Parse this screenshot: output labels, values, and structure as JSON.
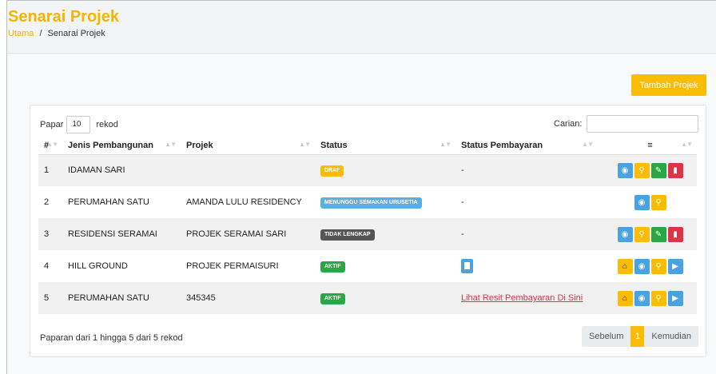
{
  "page": {
    "title": "Senarai Projek",
    "breadcrumb_home": "Utama",
    "breadcrumb_sep": "/",
    "breadcrumb_current": "Senarai Projek"
  },
  "toolbar": {
    "add_label": "Tambah Projek"
  },
  "table_controls": {
    "show_prefix": "Papar",
    "show_value": "10",
    "show_suffix": "rekod",
    "search_label": "Carian:",
    "search_value": ""
  },
  "columns": [
    "#",
    "Jenis Pembangunan",
    "Projek",
    "Status",
    "Status Pembayaran",
    "≡"
  ],
  "rows": [
    {
      "no": "1",
      "jenis": "IDAMAN SARI",
      "projek": "",
      "status": "DRAF",
      "payment": "-"
    },
    {
      "no": "2",
      "jenis": "PERUMAHAN SATU",
      "projek": "AMANDA LULU RESIDENCY",
      "status": "MENUNGGU SEMAKAN URUSETIA",
      "payment": "-"
    },
    {
      "no": "3",
      "jenis": "RESIDENSI SERAMAI",
      "projek": "PROJEK SERAMAI SARI",
      "status": "TIDAK LENGKAP",
      "payment": "-"
    },
    {
      "no": "4",
      "jenis": "HILL GROUND",
      "projek": "PROJEK PERMAISURI",
      "status": "AKTIF",
      "payment": ""
    },
    {
      "no": "5",
      "jenis": "PERUMAHAN SATU",
      "projek": "345345",
      "status": "AKTIF",
      "payment": "Lihat Resit Pembayaran Di Sini"
    }
  ],
  "status_colors": {
    "DRAF": "#fbbc05",
    "MENUNGGU SEMAKAN URUSETIA": "#5dade2",
    "TIDAK LENGKAP": "#555555",
    "AKTIF": "#28a745"
  },
  "footer": {
    "info": "Paparan dari 1 hingga 5 dari 5 rekod",
    "prev": "Sebelum",
    "page": "1",
    "next": "Kemudian"
  },
  "icons": {
    "view": "eye-icon",
    "search": "magnifier-icon",
    "edit": "edit-icon",
    "delete": "trash-icon",
    "warn": "building-warning-icon",
    "doc": "document-arrow-icon",
    "receipt": "receipt-icon"
  },
  "accent_color": "#fbbc05"
}
